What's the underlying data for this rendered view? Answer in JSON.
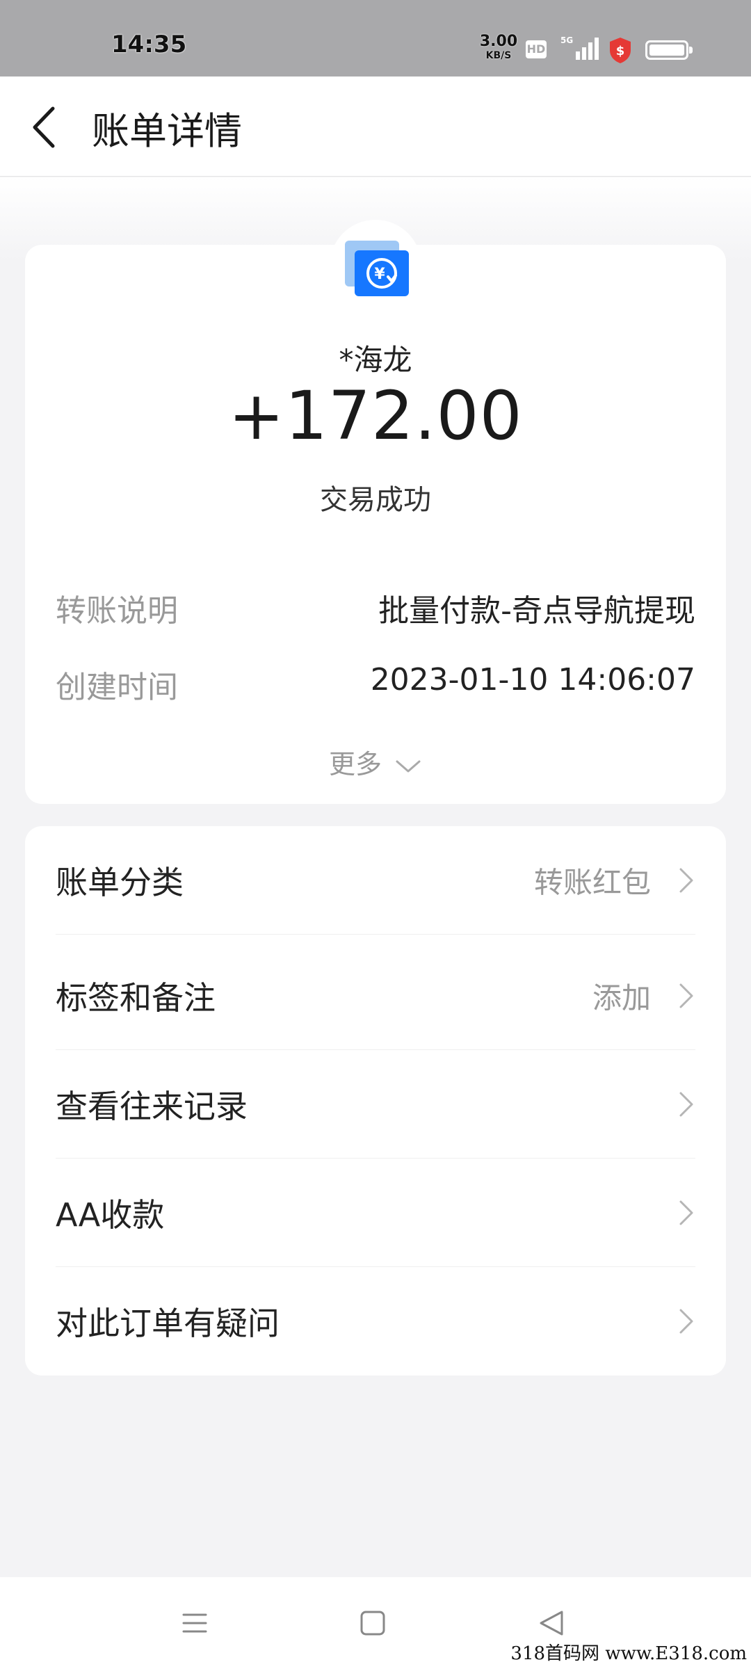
{
  "status_bar": {
    "time": "14:35",
    "net_speed_value": "3.00",
    "net_speed_unit": "KB/S",
    "hd_label": "HD",
    "network_type": "5G"
  },
  "header": {
    "title": "账单详情",
    "back_icon": "chevron-left"
  },
  "summary": {
    "payee_name": "*海龙",
    "amount": "+172.00",
    "status": "交易成功",
    "details": [
      {
        "label": "转账说明",
        "value": "批量付款-奇点导航提现"
      },
      {
        "label": "创建时间",
        "value": "2023-01-10 14:06:07"
      }
    ],
    "more_label": "更多"
  },
  "menu": {
    "items": [
      {
        "label": "账单分类",
        "value": "转账红包"
      },
      {
        "label": "标签和备注",
        "value": "添加"
      },
      {
        "label": "查看往来记录",
        "value": ""
      },
      {
        "label": "AA收款",
        "value": ""
      },
      {
        "label": "对此订单有疑问",
        "value": ""
      }
    ]
  },
  "nav_bar": {
    "icons": [
      "menu-icon",
      "home-square-icon",
      "back-triangle-icon"
    ]
  },
  "watermark": "318首码网  www.E318.com",
  "colors": {
    "accent_blue": "#1677ff",
    "light_blue": "#7fb6f5",
    "shield_red": "#e53935",
    "status_bar_gray": "#a9a9ab",
    "page_bg": "#f3f3f5"
  }
}
